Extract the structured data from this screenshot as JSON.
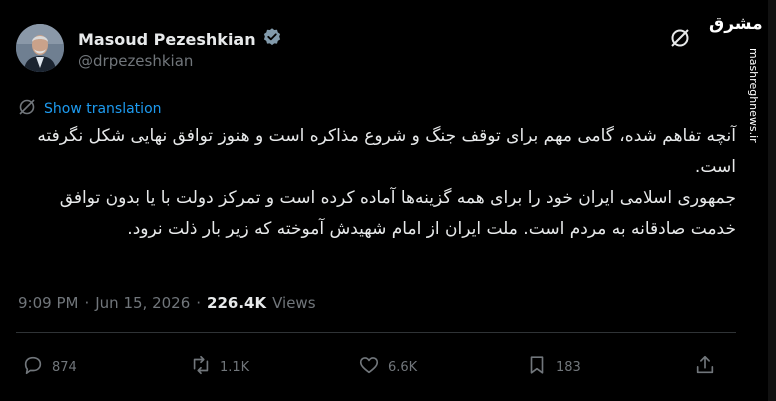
{
  "author": {
    "name": "Masoud Pezeshkian",
    "handle": "@drpezeshkian"
  },
  "translation_link": "Show translation",
  "tweet": {
    "text": "آنچه تفاهم شده، گامی مهم برای توقف جنگ و شروع مذاکره است و هنوز توافق نهایی شکل نگرفته است.\nجمهوری اسلامی ایران خود را برای همه گزینه‌ها آماده کرده است و تمرکز دولت با یا بدون توافق خدمت صادقانه به مردم است. ملت ایران از امام شهیدش آموخته که زیر بار ذلت نرود."
  },
  "meta": {
    "time": "9:09 PM",
    "dot1": "·",
    "date": "Jun 15, 2026",
    "dot2": "·",
    "views_count": "226.4K",
    "views_label": "Views"
  },
  "actions": {
    "replies": "874",
    "reposts": "1.1K",
    "likes": "6.6K",
    "bookmarks": "183"
  },
  "watermark": {
    "logo": "مشرق",
    "url": "mashreghnews.ir"
  },
  "colors": {
    "background": "#000000",
    "link": "#1d9bf0",
    "muted": "#71767b",
    "verified": "#829aab"
  }
}
